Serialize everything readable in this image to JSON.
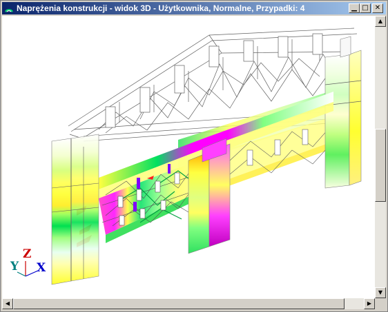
{
  "window": {
    "title": "Naprężenia konstrukcji - widok 3D - Użytkownika, Normalne, Przypadki: 4",
    "minimize_icon": "minimize-icon",
    "maximize_icon": "maximize-icon",
    "close_icon": "close-icon"
  },
  "axes": {
    "z": "Z",
    "y": "Y",
    "x": "X"
  },
  "colors": {
    "titlebar_start": "#0a246a",
    "titlebar_end": "#a6caf0",
    "stress_magenta": "#ff00ff",
    "stress_red": "#ff3030",
    "stress_green": "#00d24a",
    "stress_yellow": "#ffff40",
    "axis_x": "#0000cc",
    "axis_y": "#008080",
    "axis_z": "#cc0000"
  },
  "scrollbars": {
    "vertical_position": 0.5,
    "horizontal_position": 0.0
  }
}
